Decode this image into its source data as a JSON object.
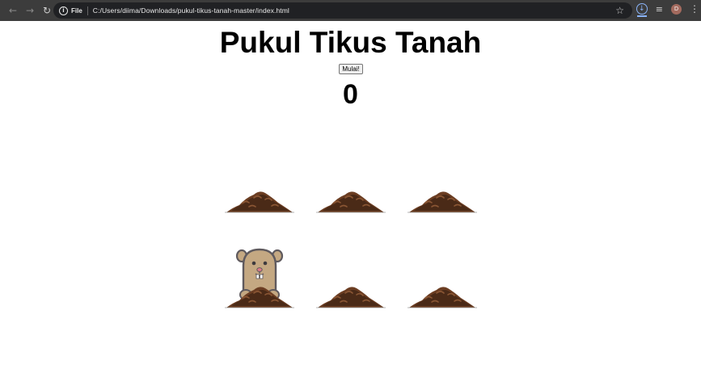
{
  "browser": {
    "file_chip_label": "File",
    "url": "C:/Users/diima/Downloads/pukul-tikus-tanah-master/index.html",
    "avatar_letter": "D"
  },
  "game": {
    "title": "Pukul Tikus Tanah",
    "start_button": "Mulai!",
    "score": "0"
  },
  "grid": {
    "rows": 2,
    "cols": 3,
    "active_mole": [
      1,
      0
    ]
  },
  "colors": {
    "dirt_dark": "#4a2a17",
    "dirt_mid": "#6b3d22",
    "dirt_light": "#8a5634",
    "mole_fur": "#c4a882",
    "mole_outline": "#5f5a5e"
  }
}
